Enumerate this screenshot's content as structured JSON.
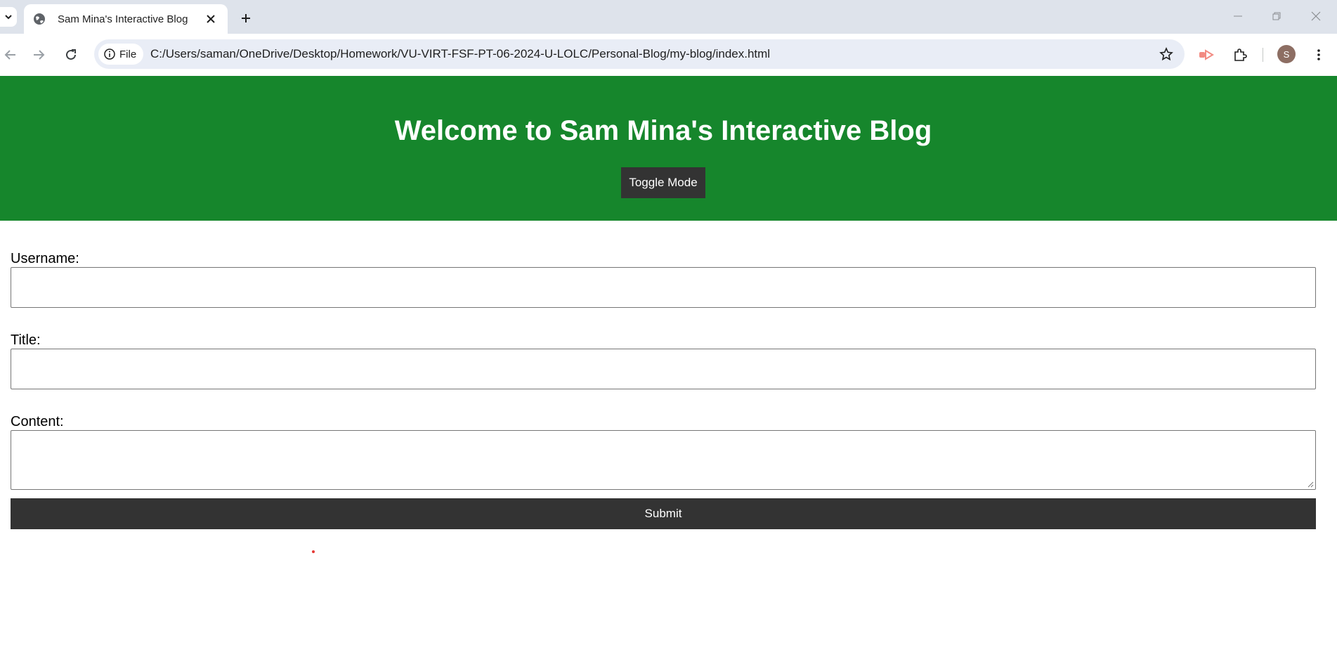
{
  "browser": {
    "tab_title": "Sam Mina's Interactive Blog",
    "omnibox_chip_label": "File",
    "url": "C:/Users/saman/OneDrive/Desktop/Homework/VU-VIRT-FSF-PT-06-2024-U-LOLC/Personal-Blog/my-blog/index.html",
    "profile_initial": "S",
    "colors": {
      "tabstrip": "#dee3eb",
      "omnibox": "#e9edf6",
      "avatar": "#8d6e63"
    }
  },
  "header": {
    "title": "Welcome to Sam Mina's Interactive Blog",
    "toggle_label": "Toggle Mode",
    "background": "#16862c"
  },
  "form": {
    "username_label": "Username:",
    "username_value": "",
    "title_label": "Title:",
    "title_value": "",
    "content_label": "Content:",
    "content_value": "",
    "submit_label": "Submit",
    "button_color": "#333333"
  }
}
